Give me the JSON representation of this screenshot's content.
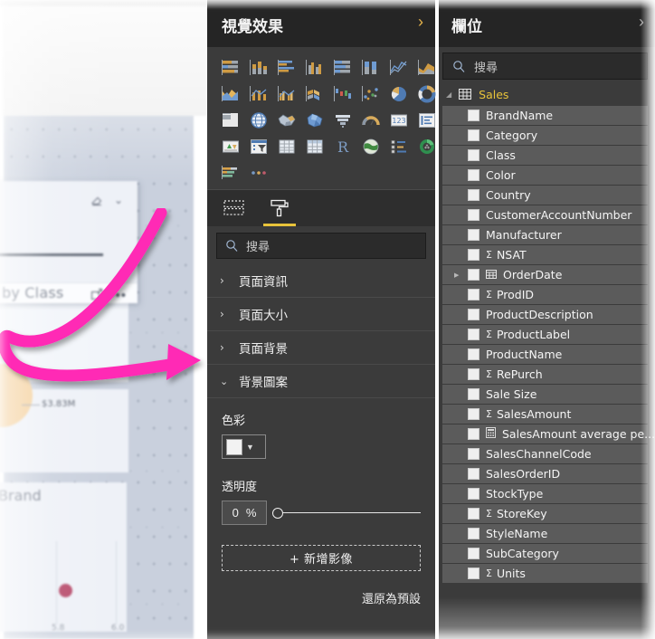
{
  "canvas": {
    "chart_title_1": "by Class",
    "chart_title_2": "Brand",
    "donut_label": "$3.83M",
    "x_tick_1": "5.8",
    "x_tick_2": "6.0"
  },
  "annotation": {
    "arrow_color": "#FF2BB5",
    "arrow_name": "pink-curved-arrow"
  },
  "visualizations": {
    "title": "視覺效果",
    "expand_icon": "chevron-right-icon",
    "icons": [
      "stacked-bar-chart",
      "stacked-column-chart",
      "clustered-bar-chart",
      "clustered-column-chart",
      "100-percent-stacked-bar-chart",
      "100-percent-stacked-column-chart",
      "line-chart",
      "area-chart",
      "stacked-area-chart",
      "line-and-stacked-column-chart",
      "line-and-clustered-column-chart",
      "ribbon-chart",
      "waterfall-chart",
      "scatter-chart",
      "pie-chart",
      "donut-chart",
      "treemap-chart",
      "map-chart",
      "filled-map-chart",
      "shape-map-chart",
      "funnel-chart",
      "gauge-chart",
      "card-visual",
      "multi-row-card",
      "kpi-visual",
      "slicer-visual",
      "table-visual",
      "matrix-visual",
      "r-script-visual",
      "arcgis-map-visual",
      "key-influencers-visual",
      "decomposition-tree-visual",
      "paginated-report-visual",
      "more-options-icon"
    ]
  },
  "format_pane": {
    "tabs": [
      {
        "name": "fields-build-tab",
        "icon": "dashed-table-icon",
        "active": false
      },
      {
        "name": "format-tab",
        "icon": "paint-roller-icon",
        "active": true
      }
    ],
    "search_placeholder": "搜尋",
    "search_icon": "search-icon",
    "sections": [
      {
        "label": "頁面資訊",
        "expanded": false
      },
      {
        "label": "頁面大小",
        "expanded": false
      },
      {
        "label": "頁面背景",
        "expanded": false
      },
      {
        "label": "背景圖案",
        "expanded": true
      }
    ],
    "wallpaper": {
      "color_label": "色彩",
      "color_value": "#FFFFFF",
      "color_caret_icon": "chevron-down-icon",
      "transparency_label": "透明度",
      "transparency_value": "0",
      "transparency_unit": "%",
      "add_image_label": "+ 新增影像",
      "revert_label": "還原為預設"
    }
  },
  "fields_pane": {
    "title": "欄位",
    "expand_icon": "chevron-right-icon",
    "search_placeholder": "搜尋",
    "search_icon": "search-icon",
    "table": {
      "name": "Sales",
      "icon": "table-icon",
      "expander": "triangle-expanded-icon"
    },
    "items": [
      {
        "label": "BrandName",
        "measure": false,
        "kind": "text"
      },
      {
        "label": "Category",
        "measure": false,
        "kind": "text"
      },
      {
        "label": "Class",
        "measure": false,
        "kind": "text"
      },
      {
        "label": "Color",
        "measure": false,
        "kind": "text"
      },
      {
        "label": "Country",
        "measure": false,
        "kind": "text"
      },
      {
        "label": "CustomerAccountNumber",
        "measure": false,
        "kind": "text"
      },
      {
        "label": "Manufacturer",
        "measure": false,
        "kind": "text"
      },
      {
        "label": "NSAT",
        "measure": true,
        "kind": "numeric"
      },
      {
        "label": "OrderDate",
        "measure": false,
        "kind": "date",
        "expandable": true
      },
      {
        "label": "ProdID",
        "measure": true,
        "kind": "numeric"
      },
      {
        "label": "ProductDescription",
        "measure": false,
        "kind": "text"
      },
      {
        "label": "ProductLabel",
        "measure": true,
        "kind": "numeric"
      },
      {
        "label": "ProductName",
        "measure": false,
        "kind": "text"
      },
      {
        "label": "RePurch",
        "measure": true,
        "kind": "numeric"
      },
      {
        "label": "Sale Size",
        "measure": false,
        "kind": "text"
      },
      {
        "label": "SalesAmount",
        "measure": true,
        "kind": "numeric"
      },
      {
        "label": "SalesAmount average pe...",
        "measure": false,
        "kind": "calc"
      },
      {
        "label": "SalesChannelCode",
        "measure": false,
        "kind": "text"
      },
      {
        "label": "SalesOrderID",
        "measure": false,
        "kind": "text"
      },
      {
        "label": "StockType",
        "measure": false,
        "kind": "text"
      },
      {
        "label": "StoreKey",
        "measure": true,
        "kind": "numeric"
      },
      {
        "label": "StyleName",
        "measure": false,
        "kind": "text"
      },
      {
        "label": "SubCategory",
        "measure": false,
        "kind": "text"
      },
      {
        "label": "Units",
        "measure": true,
        "kind": "numeric"
      }
    ]
  },
  "colors": {
    "pane_bg": "#3B3B3B",
    "header_bg": "#252525",
    "accent_yellow": "#E8C33A",
    "field_row": "#5B5B5B",
    "arrow": "#FF2BB5"
  }
}
